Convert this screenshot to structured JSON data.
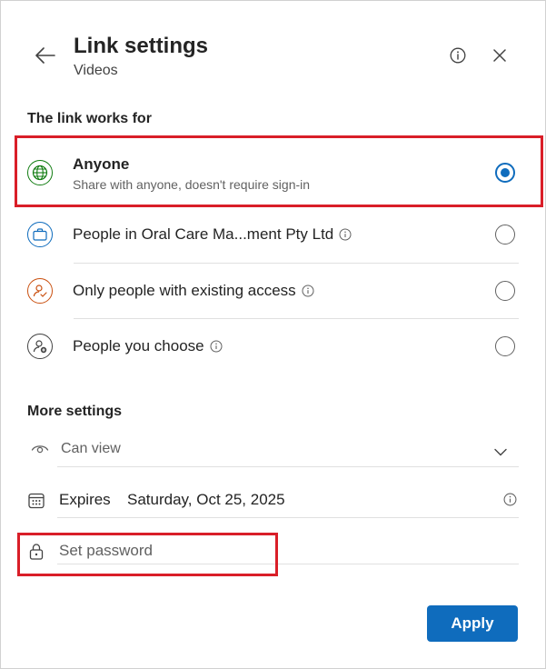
{
  "header": {
    "title": "Link settings",
    "subtitle": "Videos"
  },
  "link_section": {
    "label": "The link works for",
    "options": [
      {
        "label": "Anyone",
        "description": "Share with anyone, doesn't require sign-in",
        "icon": "globe-icon",
        "selected": true
      },
      {
        "label": "People in Oral Care Ma...ment Pty Ltd",
        "icon": "briefcase-icon",
        "selected": false,
        "has_info": true
      },
      {
        "label": "Only people with existing access",
        "icon": "person-check-icon",
        "selected": false,
        "has_info": true
      },
      {
        "label": "People you choose",
        "icon": "person-add-icon",
        "selected": false,
        "has_info": true
      }
    ]
  },
  "more_settings": {
    "label": "More settings",
    "permission": {
      "value": "Can view",
      "icon": "eye-icon"
    },
    "expires": {
      "label": "Expires",
      "value": "Saturday, Oct 25, 2025",
      "icon": "calendar-icon"
    },
    "password": {
      "placeholder": "Set password",
      "icon": "lock-icon"
    }
  },
  "footer": {
    "apply_label": "Apply"
  },
  "colors": {
    "accent": "#0f6cbd",
    "highlight": "#d91e28",
    "globe": "#107c10",
    "briefcase": "#0f6cbd",
    "person_check": "#ca5010"
  }
}
